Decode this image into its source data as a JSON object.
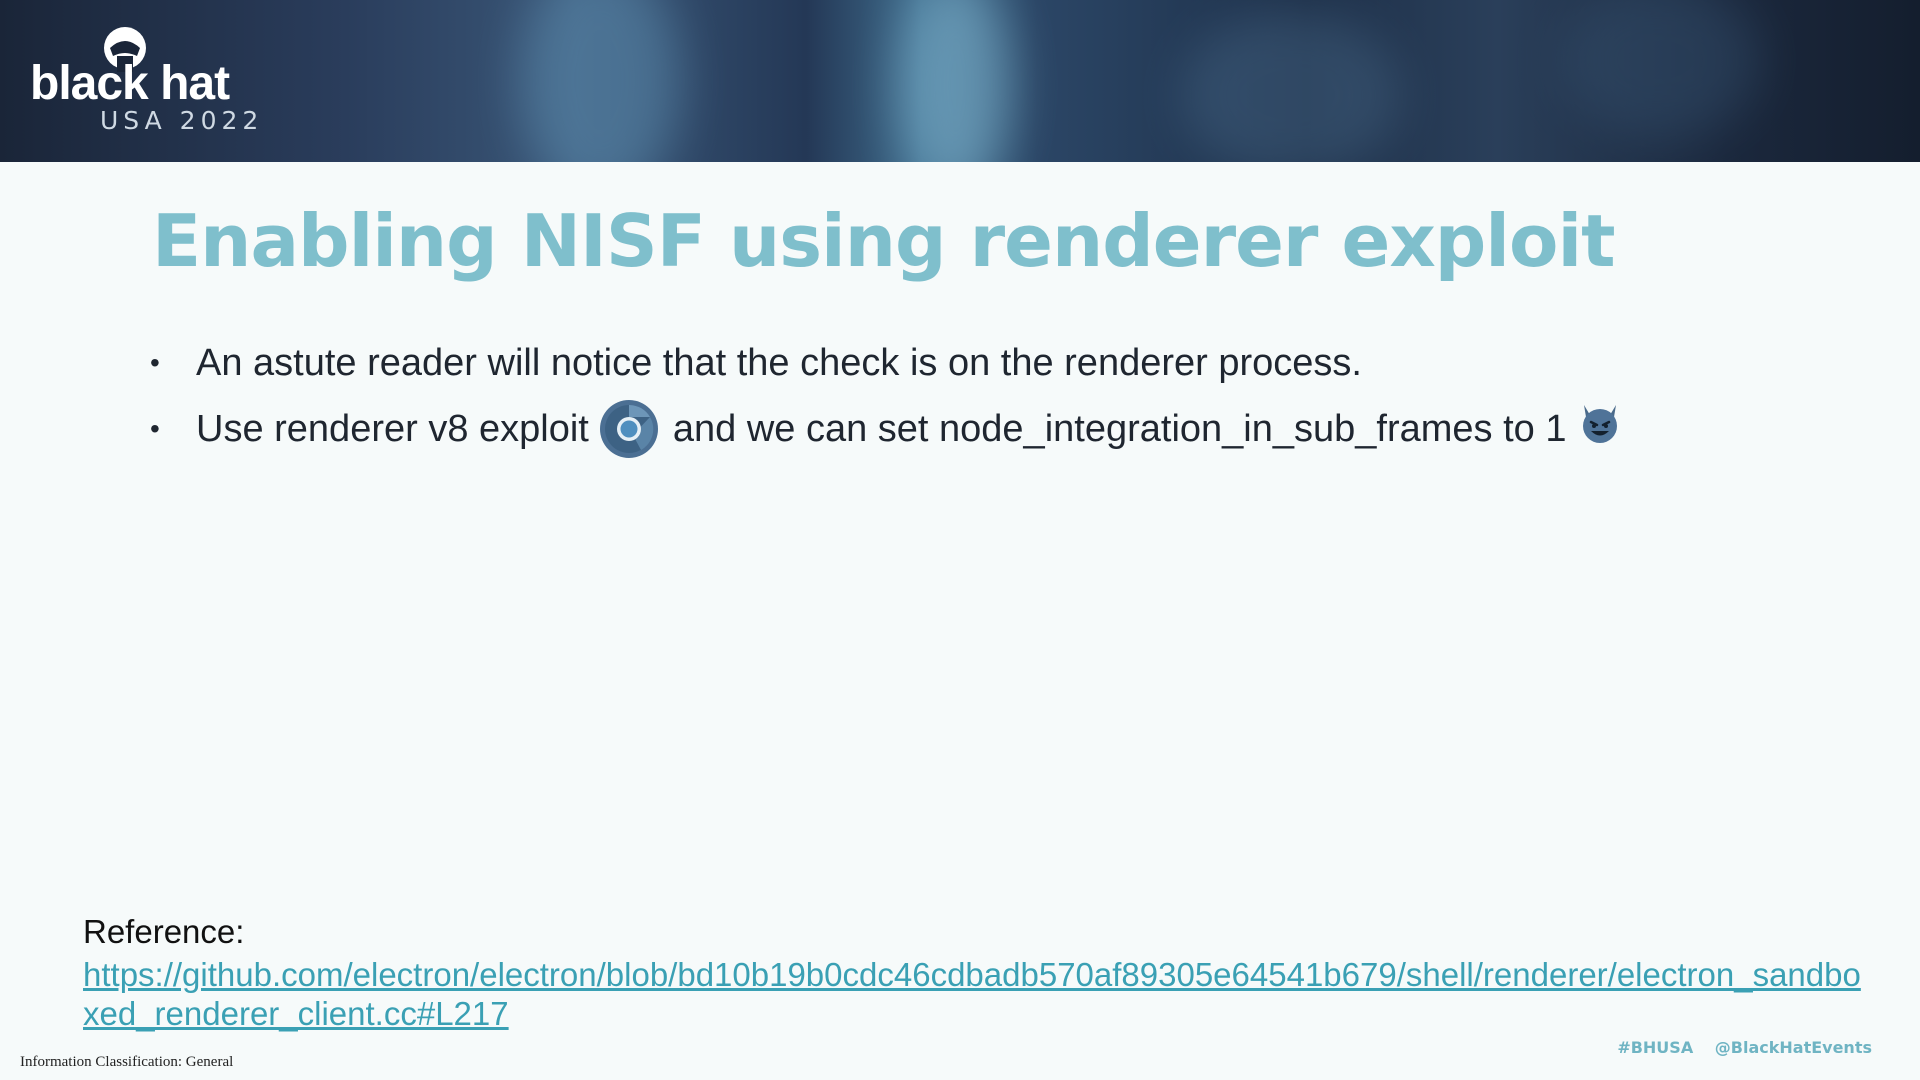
{
  "header": {
    "logo_text": "black hat",
    "event_text": "USA 2022"
  },
  "slide": {
    "title": "Enabling NISF using renderer exploit",
    "bullets": [
      {
        "text": "An astute reader will notice that the check is on the renderer process."
      },
      {
        "text_before_icon": "Use renderer v8 exploit",
        "icon": "chrome-icon",
        "text_after_icon": "and we can set node_integration_in_sub_frames to 1",
        "trailing_icon": "smiling-devil-emoji"
      }
    ],
    "reference_label": "Reference:",
    "reference_link": "https://github.com/electron/electron/blob/bd10b19b0cdc46cdbadb570af89305e64541b679/shell/renderer/electron_sandboxed_renderer_client.cc#L217"
  },
  "footer": {
    "classification": "Information Classification: General",
    "hashtag": "#BHUSA",
    "handle": "@BlackHatEvents"
  },
  "colors": {
    "title": "#7fbfcc",
    "link": "#3aa0b4",
    "header_dark": "#1a2538"
  }
}
